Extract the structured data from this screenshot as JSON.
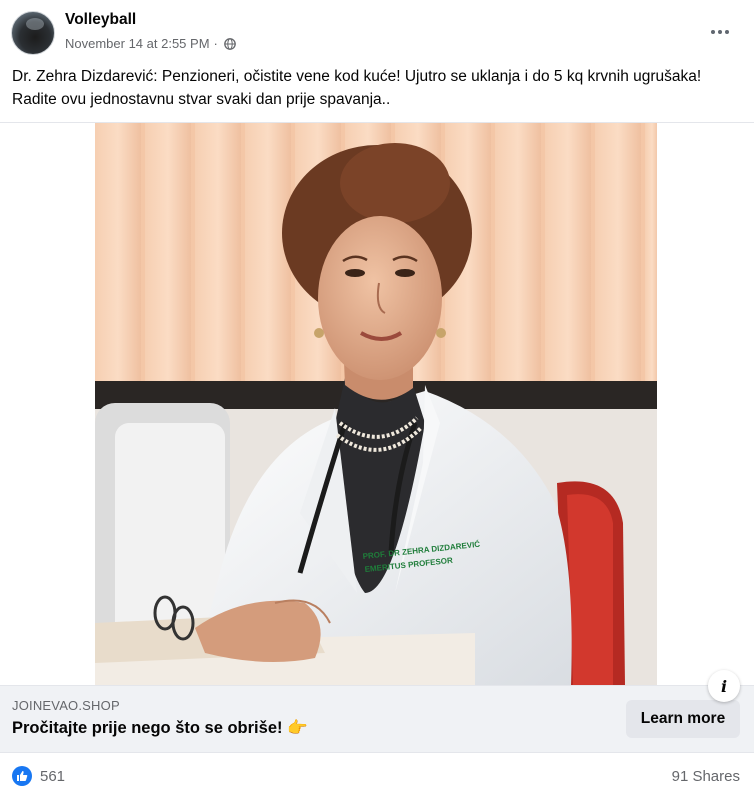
{
  "post": {
    "page_name": "Volleyball",
    "timestamp": "November 14 at 2:55 PM",
    "separator": "·",
    "privacy_icon": "globe-icon",
    "caption": "Dr. Zehra Dizdarević: Penzioneri, očistite vene kod kuće! Ujutro se uklanja i do 5 kq krvnih ugrušaka! Radite ovu jednostavnu stvar svaki dan prije spavanja..",
    "more_icon": "more-horizontal-icon"
  },
  "image": {
    "coat_label_line1": "PROF. DR ZEHRA DIZDAREVIĆ",
    "coat_label_line2": "EMERITUS PROFESOR"
  },
  "link": {
    "domain": "JOINEVAO.SHOP",
    "title": "Pročitajte prije nego što se obriše! 👉",
    "button_label": "Learn more",
    "info_label": "i"
  },
  "footer": {
    "reaction_icon": "like-icon",
    "reaction_count": "561",
    "shares": "91 Shares"
  },
  "colors": {
    "accent": "#1877f2",
    "secondary_text": "#65676b",
    "link_bar_bg": "#f0f2f5"
  }
}
